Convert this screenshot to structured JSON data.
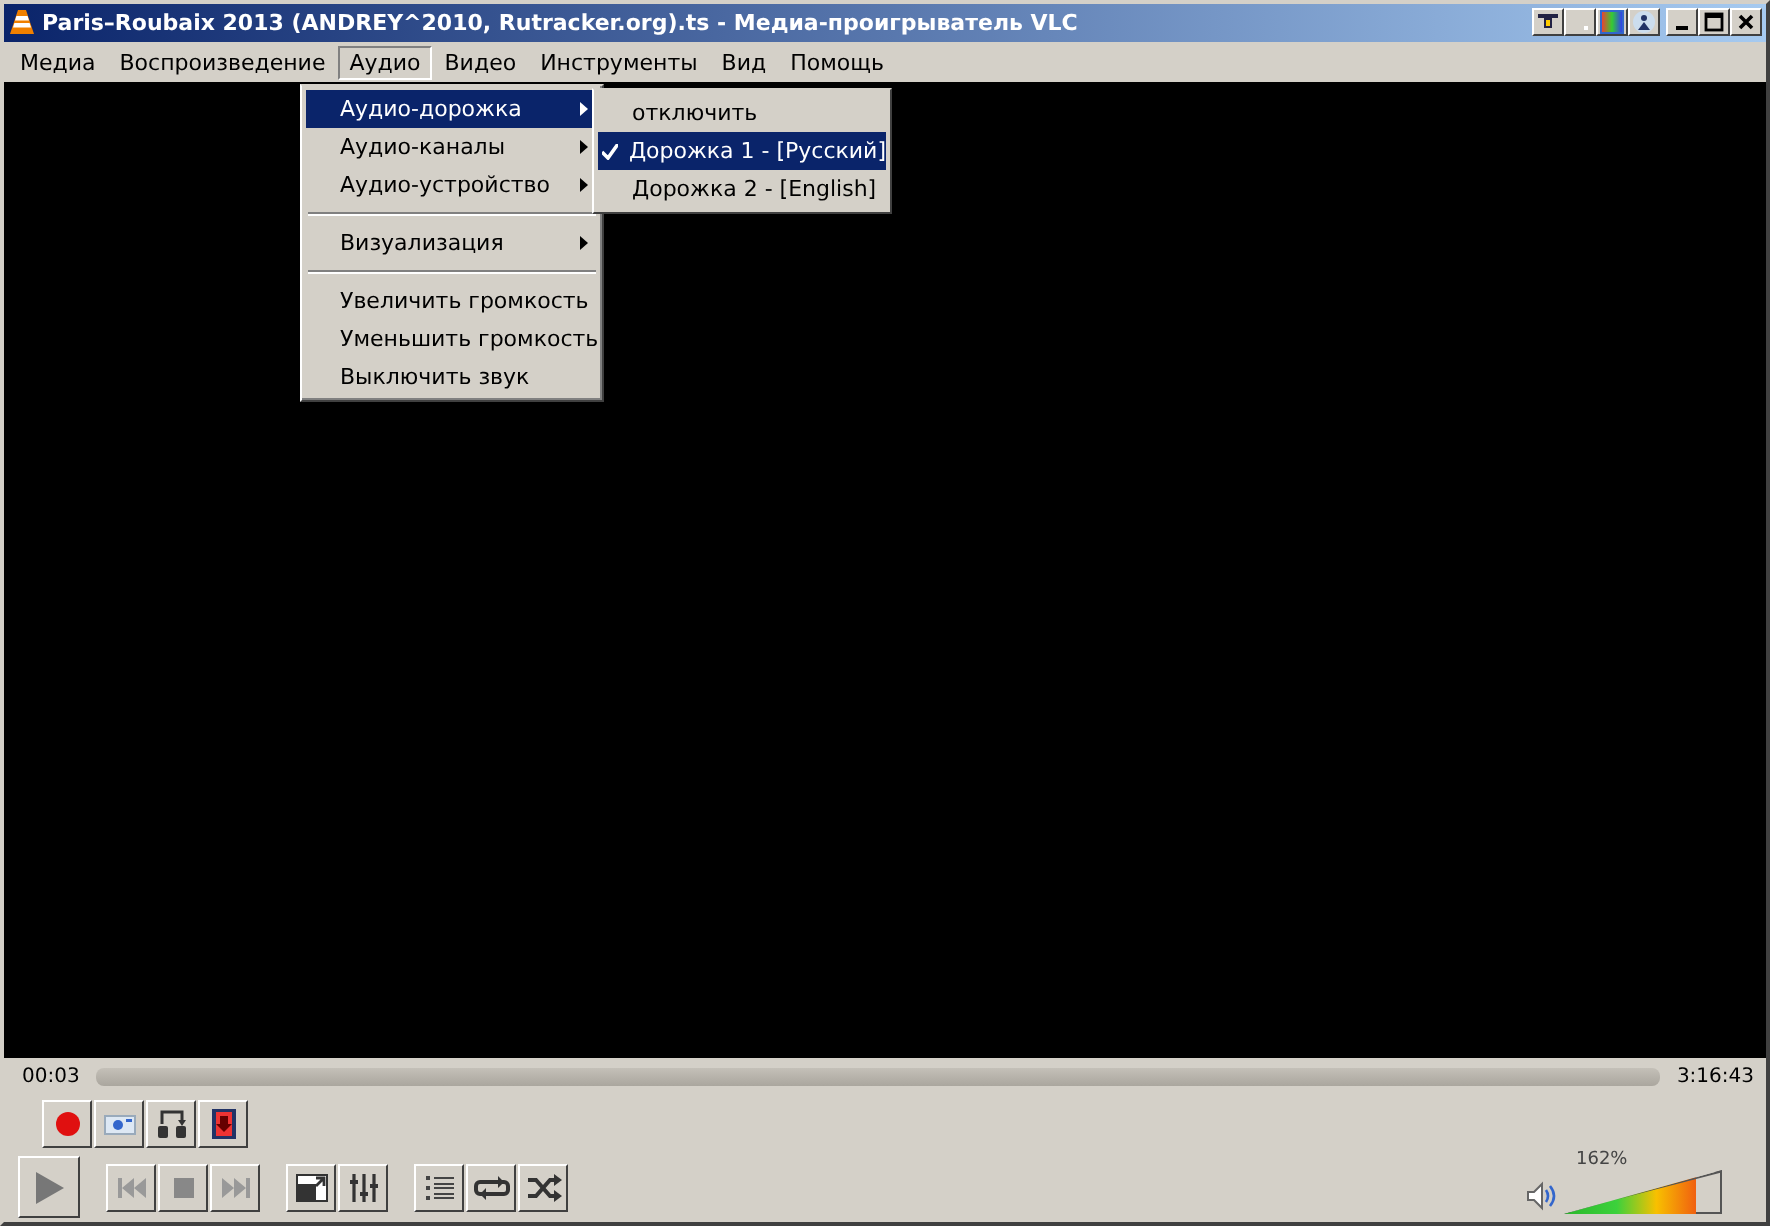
{
  "window": {
    "title": "Paris–Roubaix 2013 (ANDREY^2010, Rutracker.org).ts - Медиа-проигрыватель VLC"
  },
  "menubar": [
    {
      "label": "Медиа",
      "selected": false
    },
    {
      "label": "Воспроизведение",
      "selected": false
    },
    {
      "label": "Аудио",
      "selected": true
    },
    {
      "label": "Видео",
      "selected": false
    },
    {
      "label": "Инструменты",
      "selected": false
    },
    {
      "label": "Вид",
      "selected": false
    },
    {
      "label": "Помощь",
      "selected": false
    }
  ],
  "audio_menu": [
    {
      "kind": "item",
      "label": "Аудио-дорожка",
      "submenu": true,
      "selected": true
    },
    {
      "kind": "item",
      "label": "Аудио-каналы",
      "submenu": true,
      "selected": false
    },
    {
      "kind": "item",
      "label": "Аудио-устройство",
      "submenu": true,
      "selected": false
    },
    {
      "kind": "separator"
    },
    {
      "kind": "item",
      "label": "Визуализация",
      "submenu": true,
      "selected": false
    },
    {
      "kind": "separator"
    },
    {
      "kind": "item",
      "label": "Увеличить громкость",
      "submenu": false,
      "selected": false
    },
    {
      "kind": "item",
      "label": "Уменьшить громкость",
      "submenu": false,
      "selected": false
    },
    {
      "kind": "item",
      "label": "Выключить звук",
      "submenu": false,
      "selected": false
    }
  ],
  "track_menu": [
    {
      "label": "отключить",
      "checked": false,
      "selected": false
    },
    {
      "label": "Дорожка 1 - [Русский]",
      "checked": true,
      "selected": true
    },
    {
      "label": "Дорожка 2 - [English]",
      "checked": false,
      "selected": false
    }
  ],
  "seek": {
    "elapsed": "00:03",
    "total": "3:16:43"
  },
  "volume": {
    "reading": "162%",
    "level": 0.83
  }
}
